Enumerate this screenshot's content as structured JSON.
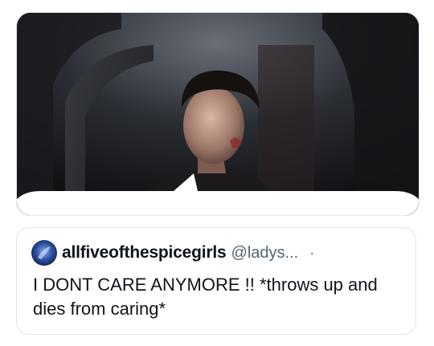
{
  "quoted_tweet": {
    "display_name": "allfiveofthespicegirls",
    "handle": "@ladys...",
    "separator": "·",
    "text": "I DONT CARE ANYMORE !! *throws up and dies from caring*"
  },
  "media": {
    "description_icon": "video-still-icon"
  },
  "colors": {
    "text_primary": "#0f1419",
    "text_secondary": "#536471",
    "border": "#e0e4e8"
  }
}
